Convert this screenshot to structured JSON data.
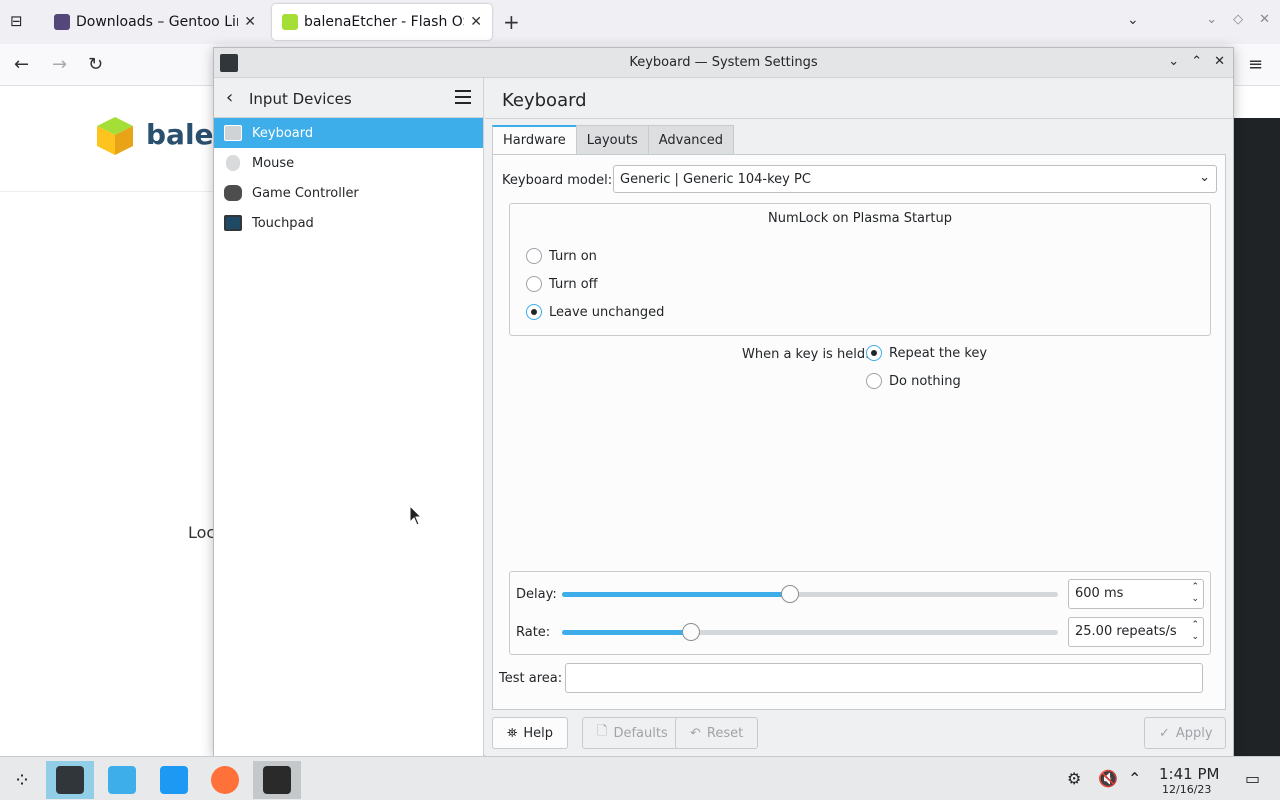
{
  "browser": {
    "tabs": [
      {
        "label": "Downloads – Gentoo Linux",
        "favicon": "gentoo-icon",
        "active": false
      },
      {
        "label": "balenaEtcher - Flash OS im",
        "favicon": "balena-cube-icon",
        "active": true
      }
    ],
    "page": {
      "logo_text": "bale",
      "loc_text": "Loc"
    }
  },
  "window": {
    "title": "Keyboard — System Settings"
  },
  "sidebar": {
    "title": "Input Devices",
    "items": [
      {
        "label": "Keyboard",
        "icon": "keyboard-icon",
        "active": true
      },
      {
        "label": "Mouse",
        "icon": "mouse-icon",
        "active": false
      },
      {
        "label": "Game Controller",
        "icon": "gamepad-icon",
        "active": false
      },
      {
        "label": "Touchpad",
        "icon": "touchpad-icon",
        "active": false
      }
    ]
  },
  "main": {
    "title": "Keyboard",
    "tabs": [
      {
        "label": "Hardware",
        "active": true
      },
      {
        "label": "Layouts",
        "active": false
      },
      {
        "label": "Advanced",
        "active": false
      }
    ],
    "keyboard_model_label": "Keyboard model:",
    "keyboard_model_value": "Generic | Generic 104-key PC",
    "numlock": {
      "title": "NumLock on Plasma Startup",
      "options": [
        {
          "label": "Turn on",
          "selected": false
        },
        {
          "label": "Turn off",
          "selected": false
        },
        {
          "label": "Leave unchanged",
          "selected": true
        }
      ]
    },
    "key_held": {
      "label": "When a key is held:",
      "options": [
        {
          "label": "Repeat the key",
          "selected": true
        },
        {
          "label": "Do nothing",
          "selected": false
        }
      ]
    },
    "delay": {
      "label": "Delay:",
      "value": "600 ms",
      "fraction": 0.46
    },
    "rate": {
      "label": "Rate:",
      "value": "25.00 repeats/s",
      "fraction": 0.26
    },
    "test_area_label": "Test area:",
    "buttons": {
      "help": "Help",
      "defaults": "Defaults",
      "reset": "Reset",
      "apply": "Apply"
    }
  },
  "taskbar": {
    "time": "1:41 PM",
    "date": "12/16/23"
  },
  "colors": {
    "accent": "#3daee9",
    "active_taskbar": "#93cee9"
  }
}
